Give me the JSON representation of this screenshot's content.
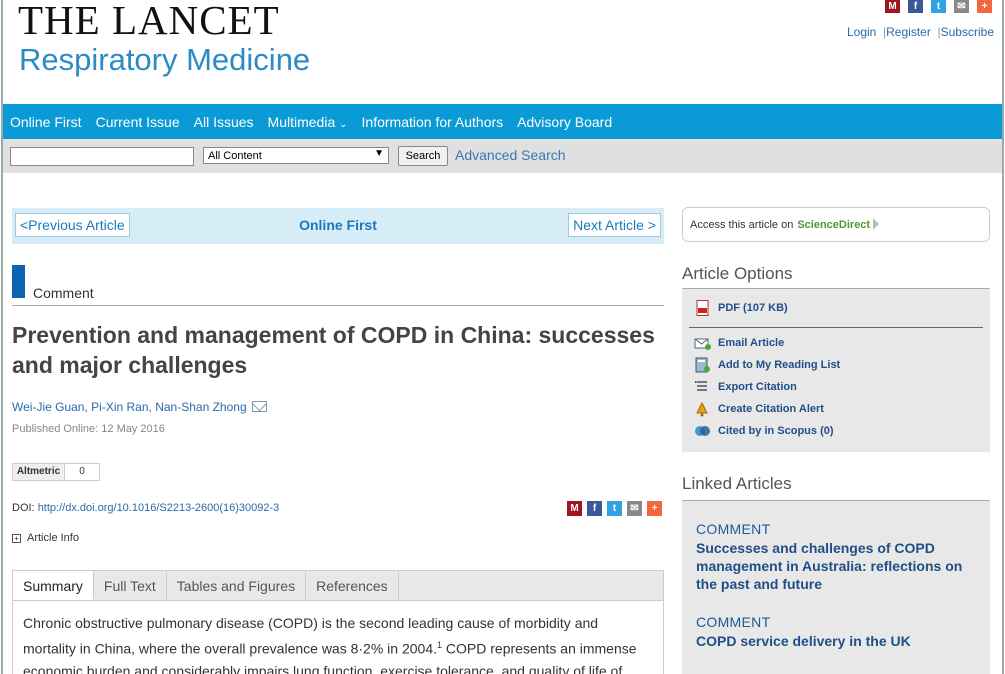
{
  "header": {
    "journal": "THE LANCET",
    "subtitle": "Respiratory Medicine",
    "share_icons": [
      "mendeley-icon",
      "facebook-icon",
      "twitter-icon",
      "email-icon",
      "addthis-icon"
    ],
    "user_links": [
      "Login",
      "Register",
      "Subscribe"
    ],
    "user_link_separator": "|"
  },
  "nav": {
    "items": [
      "Online First",
      "Current Issue",
      "All Issues",
      "Multimedia",
      "Information for Authors",
      "Advisory Board"
    ],
    "dropdown_caret": "⌄"
  },
  "search": {
    "input_value": "",
    "scope_selected": "All Content",
    "button_label": "Search",
    "advanced_label": "Advanced Search"
  },
  "article_nav": {
    "prev_label": "<Previous Article",
    "center_label": "Online First",
    "next_label": "Next Article >"
  },
  "article": {
    "type": "Comment",
    "title": "Prevention and management of COPD in China: successes and major challenges",
    "authors": [
      "Wei-Jie Guan",
      "Pi-Xin Ran",
      "Nan-Shan Zhong"
    ],
    "author_separator": ",",
    "published": "Published Online: 12 May 2016",
    "altmetric_label": "Altmetric",
    "altmetric_score": "0",
    "doi_label": "DOI:",
    "doi_link": "http://dx.doi.org/10.1016/S2213-2600(16)30092-3",
    "article_info_label": "Article Info",
    "article_info_toggle": "+",
    "tabs": [
      "Summary",
      "Full Text",
      "Tables and Figures",
      "References"
    ],
    "active_tab": "Summary",
    "summary_part1": "Chronic obstructive pulmonary disease (COPD) is the second leading cause of morbidity and mortality in China, where the overall prevalence was 8·2% in 2004.",
    "summary_sup": "1",
    "summary_part2": " COPD represents an immense economic burden and considerably impairs lung function, exercise tolerance, and quality of life of"
  },
  "sidebar": {
    "access_prefix": "Access this article on",
    "access_provider": "ScienceDirect",
    "options_title": "Article Options",
    "options": [
      {
        "label": "PDF (107 KB)",
        "icon": "pdf-icon"
      },
      {
        "label": "Email Article",
        "icon": "email-article-icon"
      },
      {
        "label": "Add to My Reading List",
        "icon": "reading-list-icon"
      },
      {
        "label": "Export Citation",
        "icon": "export-citation-icon"
      },
      {
        "label": "Create Citation Alert",
        "icon": "citation-alert-icon"
      },
      {
        "label": "Cited by in Scopus (0)",
        "icon": "scopus-icon"
      }
    ],
    "linked_title": "Linked Articles",
    "linked": [
      {
        "category": "COMMENT",
        "title": "Successes and challenges of COPD management in Australia: reflections on the past and future"
      },
      {
        "category": "COMMENT",
        "title": "COPD service delivery in the UK"
      }
    ]
  },
  "colors": {
    "nav_bg": "#0a9ad6",
    "logo_blue": "#2b8bc9",
    "link_blue": "#2a6aa8",
    "type_bar": "#0a63b3",
    "sciencedirect_green": "#4b9a2c",
    "mendeley": "#9d1620",
    "facebook": "#3b5998",
    "twitter": "#2fa3e6",
    "email": "#888888",
    "addthis": "#f26641"
  }
}
